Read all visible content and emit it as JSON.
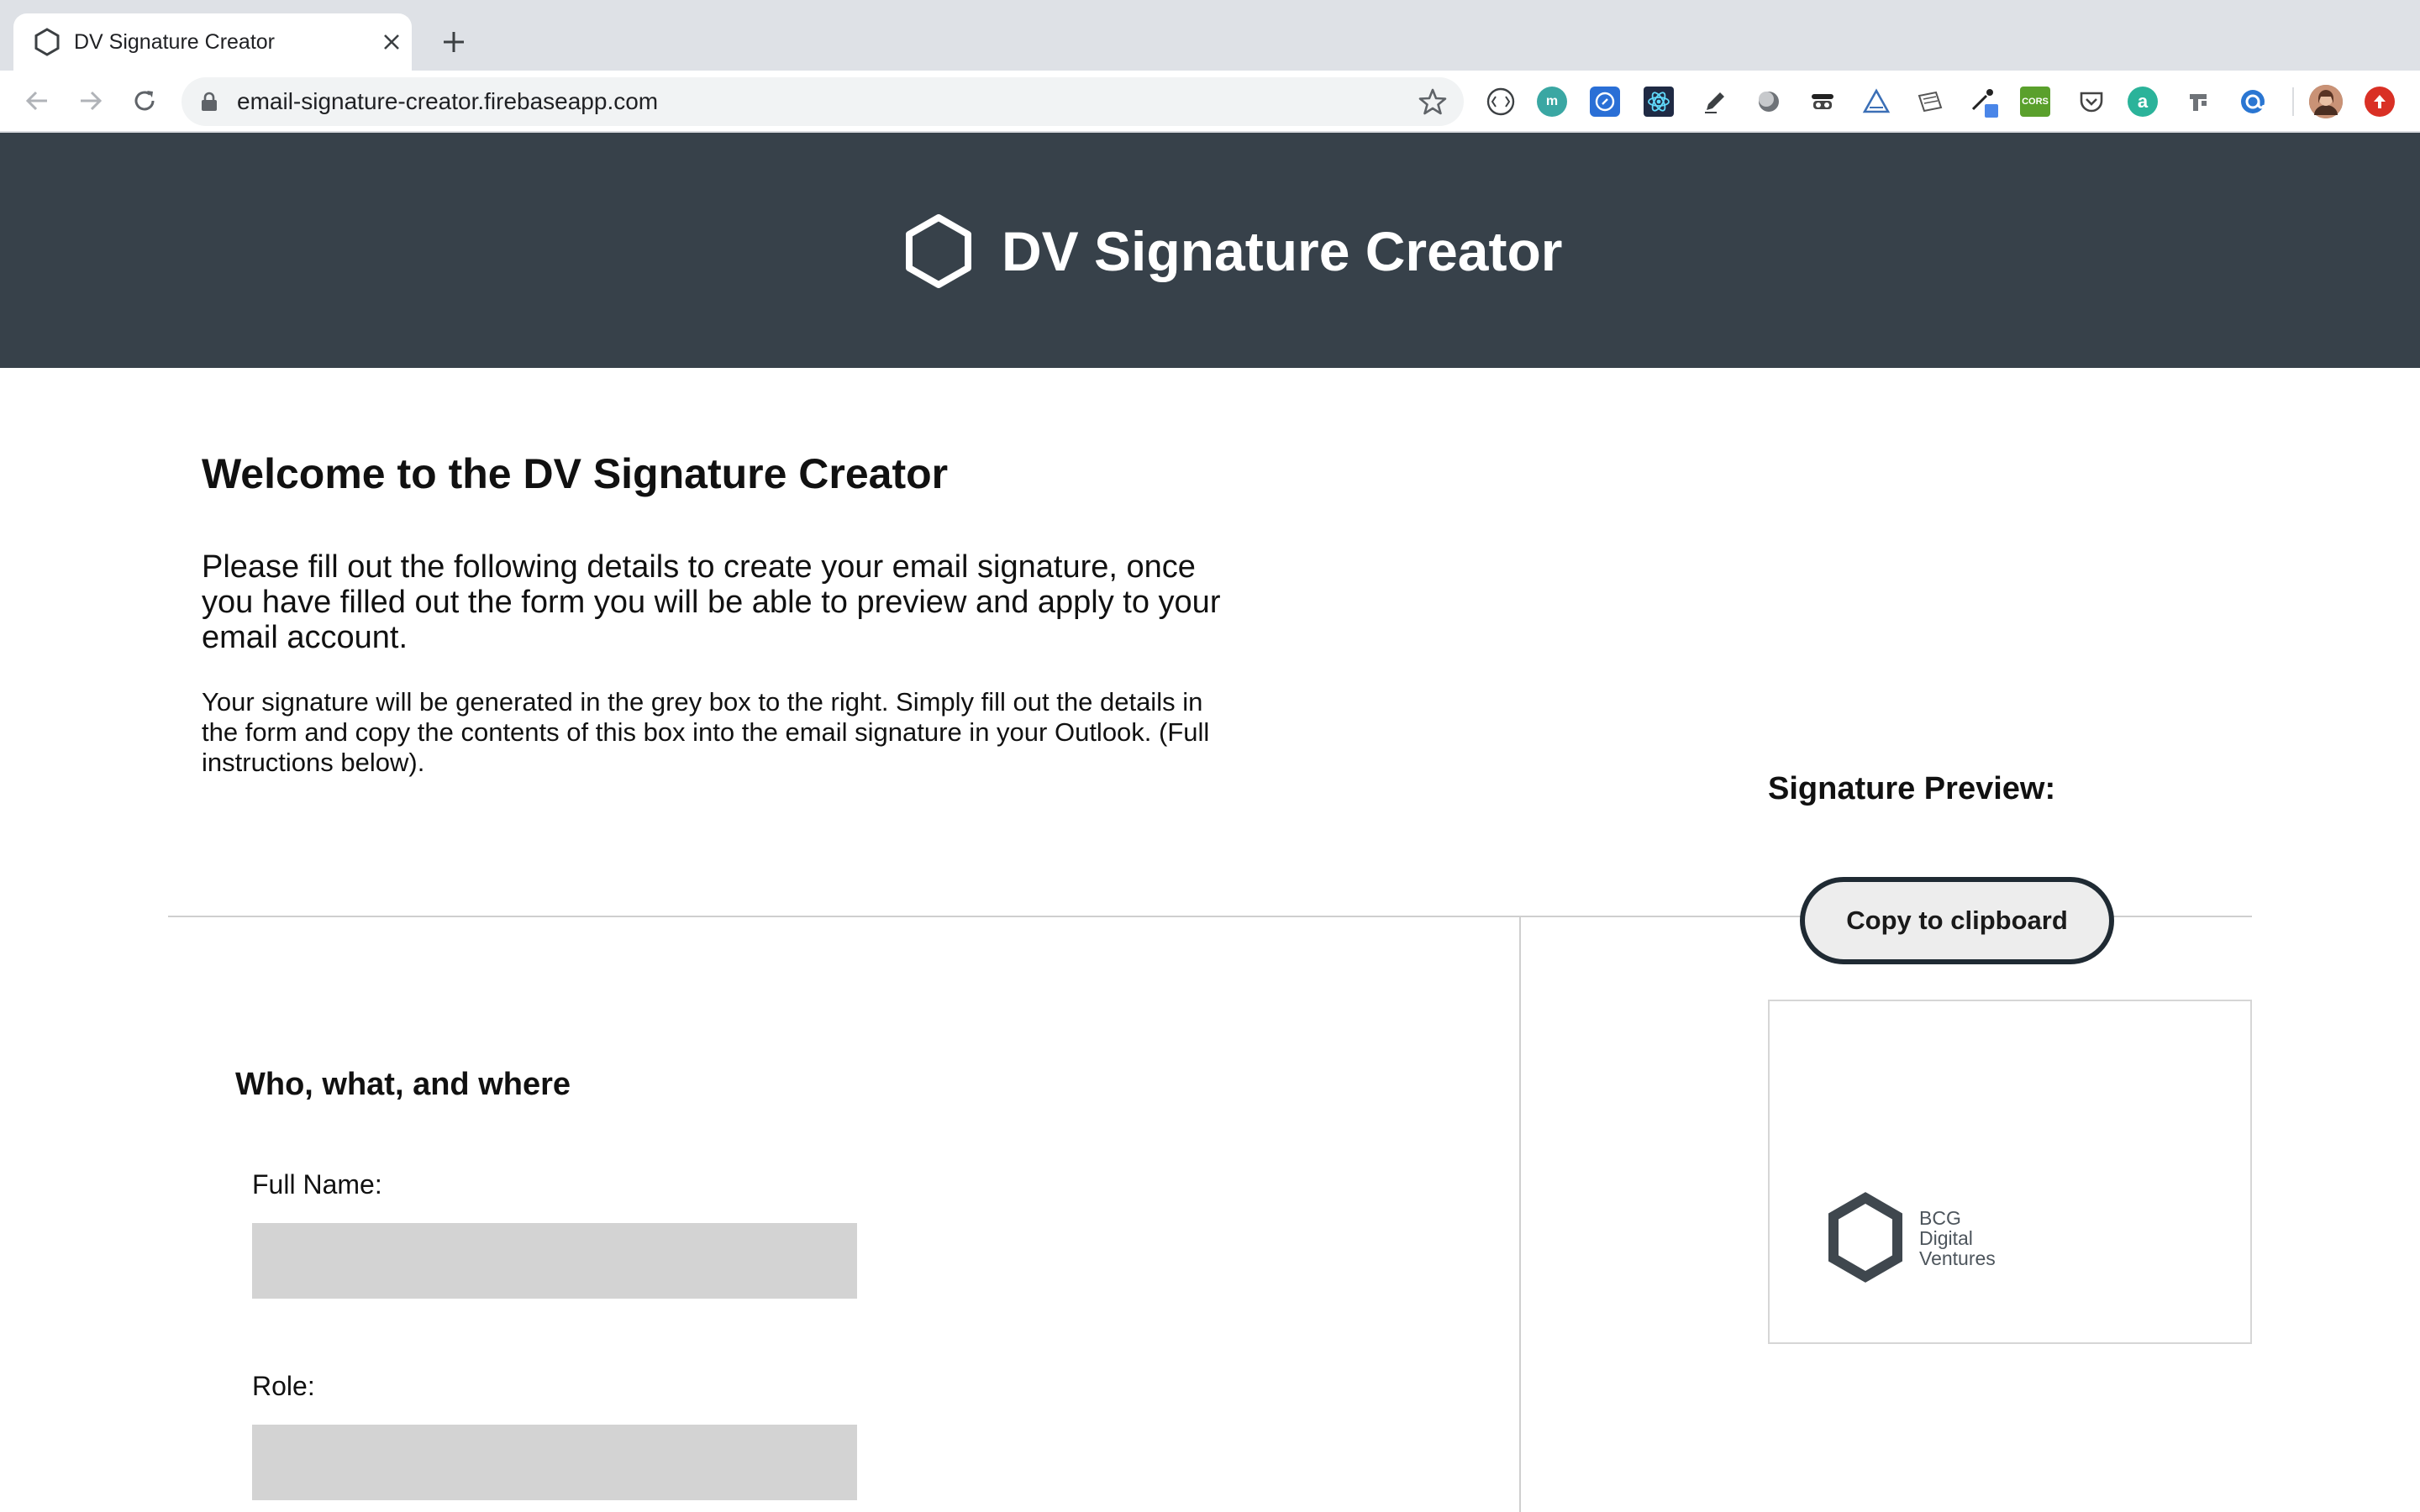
{
  "browser": {
    "tab_title": "DV Signature Creator",
    "url": "email-signature-creator.firebaseapp.com",
    "extensions": [
      "code-brackets-icon",
      "m-icon",
      "compass-icon",
      "react-atom-icon",
      "pen-icon",
      "circle-icon",
      "mask-icon",
      "triangle-icon",
      "notebook-icon",
      "eyedropper-icon",
      "cors-icon",
      "pocket-icon",
      "a-icon",
      "pin-icon",
      "at-icon",
      "profile-avatar",
      "update-icon"
    ],
    "ext_labels": {
      "m": "m",
      "cors": "CORS",
      "a": "a"
    }
  },
  "header": {
    "title": "DV Signature Creator"
  },
  "intro": {
    "heading": "Welcome to the DV Signature Creator",
    "lead": "Please fill out the following details to create your email signature, once you have filled out the form you will be able to preview and apply to your email account.",
    "detail": "Your signature will be generated in the grey box to the right. Simply fill out the details in the form and copy the contents of this box into the email signature in your Outlook. (Full instructions below)."
  },
  "preview": {
    "label": "Signature Preview:",
    "copy_button": "Copy to clipboard",
    "logo_lines": [
      "BCG",
      "Digital",
      "Ventures"
    ]
  },
  "form": {
    "section_title": "Who, what, and where",
    "fields": [
      {
        "label": "Full Name:",
        "value": ""
      },
      {
        "label": "Role:",
        "value": ""
      }
    ]
  },
  "colors": {
    "header_bg": "#37414a",
    "input_bg": "#d3d3d3",
    "button_border": "#1f2a33"
  }
}
